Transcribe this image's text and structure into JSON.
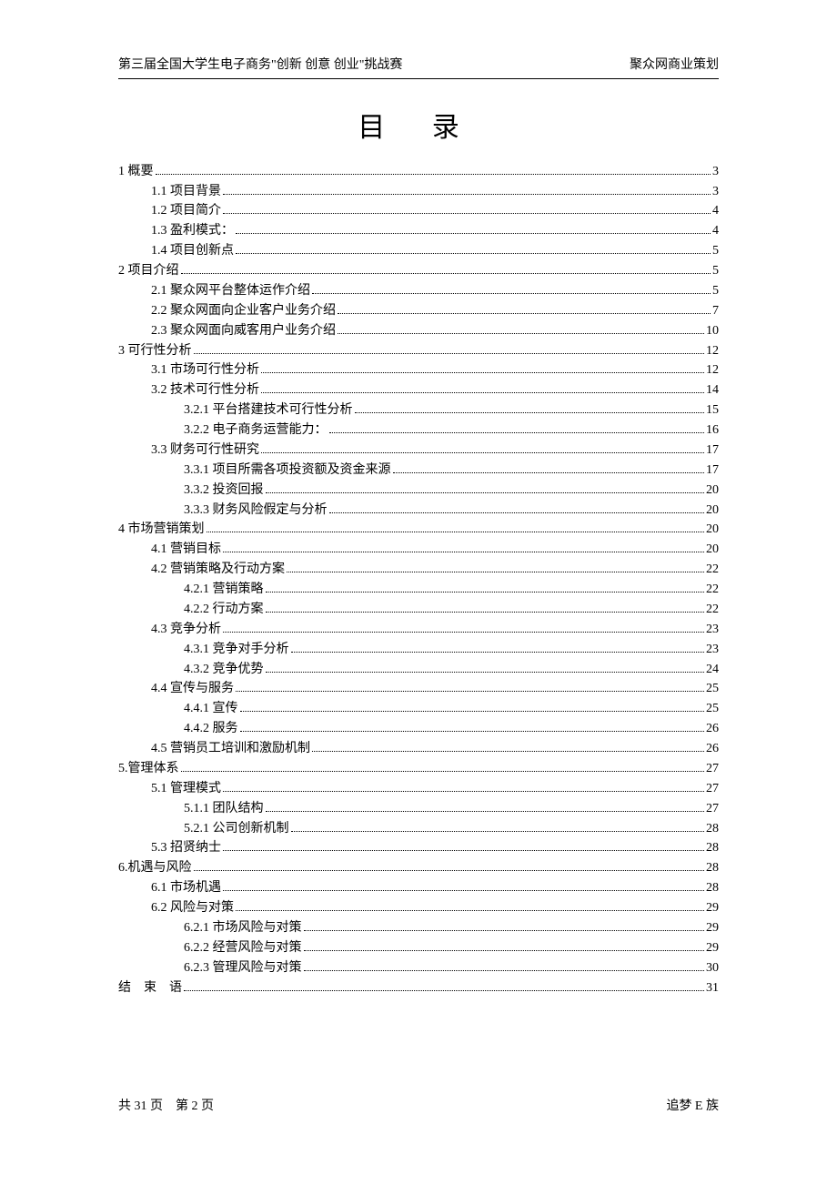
{
  "header": {
    "left": "第三届全国大学生电子商务\"创新 创意 创业\"挑战赛",
    "right": "聚众网商业策划"
  },
  "title": "目 录",
  "toc": [
    {
      "level": 1,
      "label": "1 概要",
      "page": "3"
    },
    {
      "level": 2,
      "label": "1.1 项目背景",
      "page": "3"
    },
    {
      "level": 2,
      "label": "1.2 项目简介",
      "page": "4"
    },
    {
      "level": 2,
      "label": "1.3 盈利模式：",
      "page": "4"
    },
    {
      "level": 2,
      "label": "1.4 项目创新点",
      "page": "5"
    },
    {
      "level": 1,
      "label": "2 项目介绍",
      "page": "5"
    },
    {
      "level": 2,
      "label": "2.1 聚众网平台整体运作介绍",
      "page": "5"
    },
    {
      "level": 2,
      "label": "2.2 聚众网面向企业客户业务介绍",
      "page": "7"
    },
    {
      "level": 2,
      "label": "2.3 聚众网面向威客用户业务介绍",
      "page": "10"
    },
    {
      "level": 1,
      "label": "3 可行性分析",
      "page": "12"
    },
    {
      "level": 2,
      "label": "3.1 市场可行性分析",
      "page": "12"
    },
    {
      "level": 2,
      "label": "3.2 技术可行性分析",
      "page": "14"
    },
    {
      "level": 3,
      "label": "3.2.1 平台搭建技术可行性分析",
      "page": "15"
    },
    {
      "level": 3,
      "label": "3.2.2 电子商务运营能力：",
      "page": "16"
    },
    {
      "level": 2,
      "label": "3.3 财务可行性研究",
      "page": "17"
    },
    {
      "level": 3,
      "label": "3.3.1 项目所需各项投资额及资金来源",
      "page": "17"
    },
    {
      "level": 3,
      "label": "3.3.2 投资回报",
      "page": "20"
    },
    {
      "level": 3,
      "label": "3.3.3 财务风险假定与分析",
      "page": "20"
    },
    {
      "level": 1,
      "label": "4 市场营销策划",
      "page": "20"
    },
    {
      "level": 2,
      "label": "4.1 营销目标",
      "page": "20"
    },
    {
      "level": 2,
      "label": "4.2 营销策略及行动方案",
      "page": "22"
    },
    {
      "level": 3,
      "label": "4.2.1 营销策略",
      "page": "22"
    },
    {
      "level": 3,
      "label": "4.2.2 行动方案",
      "page": "22"
    },
    {
      "level": 2,
      "label": "4.3 竞争分析",
      "page": "23"
    },
    {
      "level": 3,
      "label": "4.3.1 竞争对手分析",
      "page": "23"
    },
    {
      "level": 3,
      "label": "4.3.2 竞争优势",
      "page": "24"
    },
    {
      "level": 2,
      "label": "4.4 宣传与服务",
      "page": "25"
    },
    {
      "level": 3,
      "label": "4.4.1 宣传",
      "page": "25"
    },
    {
      "level": 3,
      "label": "4.4.2 服务",
      "page": "26"
    },
    {
      "level": 2,
      "label": "4.5 营销员工培训和激励机制",
      "page": "26"
    },
    {
      "level": 1,
      "label": "5.管理体系",
      "page": "27"
    },
    {
      "level": 2,
      "label": "5.1 管理模式",
      "page": "27"
    },
    {
      "level": 3,
      "label": "5.1.1 团队结构",
      "page": "27"
    },
    {
      "level": 3,
      "label": "5.2.1 公司创新机制",
      "page": "28"
    },
    {
      "level": 2,
      "label": "5.3  招贤纳士",
      "page": "28"
    },
    {
      "level": 1,
      "label": "6.机遇与风险",
      "page": "28"
    },
    {
      "level": 2,
      "label": "6.1 市场机遇",
      "page": "28"
    },
    {
      "level": 2,
      "label": "6.2 风险与对策",
      "page": "29"
    },
    {
      "level": 3,
      "label": "6.2.1 市场风险与对策",
      "page": "29"
    },
    {
      "level": 3,
      "label": "6.2.2 经营风险与对策",
      "page": "29"
    },
    {
      "level": 3,
      "label": "6.2.3 管理风险与对策",
      "page": "30"
    },
    {
      "level": 1,
      "label": "结　束　语",
      "page": "31"
    }
  ],
  "footer": {
    "left": "共 31 页　第 2 页",
    "right": "追梦 E 族"
  }
}
